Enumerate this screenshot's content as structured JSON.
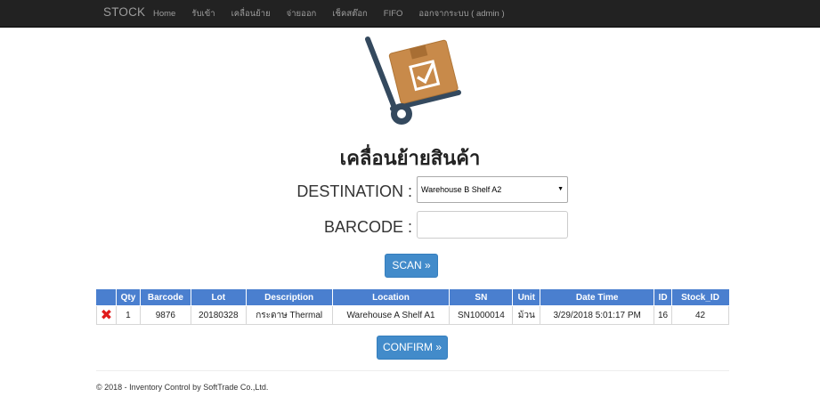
{
  "nav": {
    "brand": "STOCK",
    "items": [
      "Home",
      "รับเข้า",
      "เคลื่อนย้าย",
      "จ่ายออก",
      "เช็คสต๊อก",
      "FIFO",
      "ออกจากระบบ ( admin )"
    ]
  },
  "page": {
    "title": "เคลื่อนย้ายสินค้า",
    "destination_label": "DESTINATION :",
    "destination_value": "Warehouse B Shelf A2",
    "barcode_label": "BARCODE :",
    "barcode_value": "",
    "scan_label": "SCAN »",
    "confirm_label": "CONFIRM »"
  },
  "table": {
    "headers": [
      "",
      "Qty",
      "Barcode",
      "Lot",
      "Description",
      "Location",
      "SN",
      "Unit",
      "Date Time",
      "ID",
      "Stock_ID"
    ],
    "rows": [
      {
        "delete_icon": "✖",
        "qty": "1",
        "barcode": "9876",
        "lot": "20180328",
        "description": "กระดาษ Thermal",
        "location": "Warehouse A Shelf A1",
        "sn": "SN1000014",
        "unit": "ม้วน",
        "datetime": "3/29/2018 5:01:17 PM",
        "id": "16",
        "stock_id": "42"
      }
    ]
  },
  "footer": {
    "text": "© 2018 - Inventory Control by SoftTrade Co.,Ltd."
  },
  "colors": {
    "navbar": "#222222",
    "primary": "#428bca",
    "table_header": "#4a7fcf",
    "delete": "#e01b1b"
  },
  "icons": {
    "illustration": "hand-truck-box-check-icon",
    "delete": "delete-x-icon",
    "select_caret": "caret-down-icon"
  }
}
